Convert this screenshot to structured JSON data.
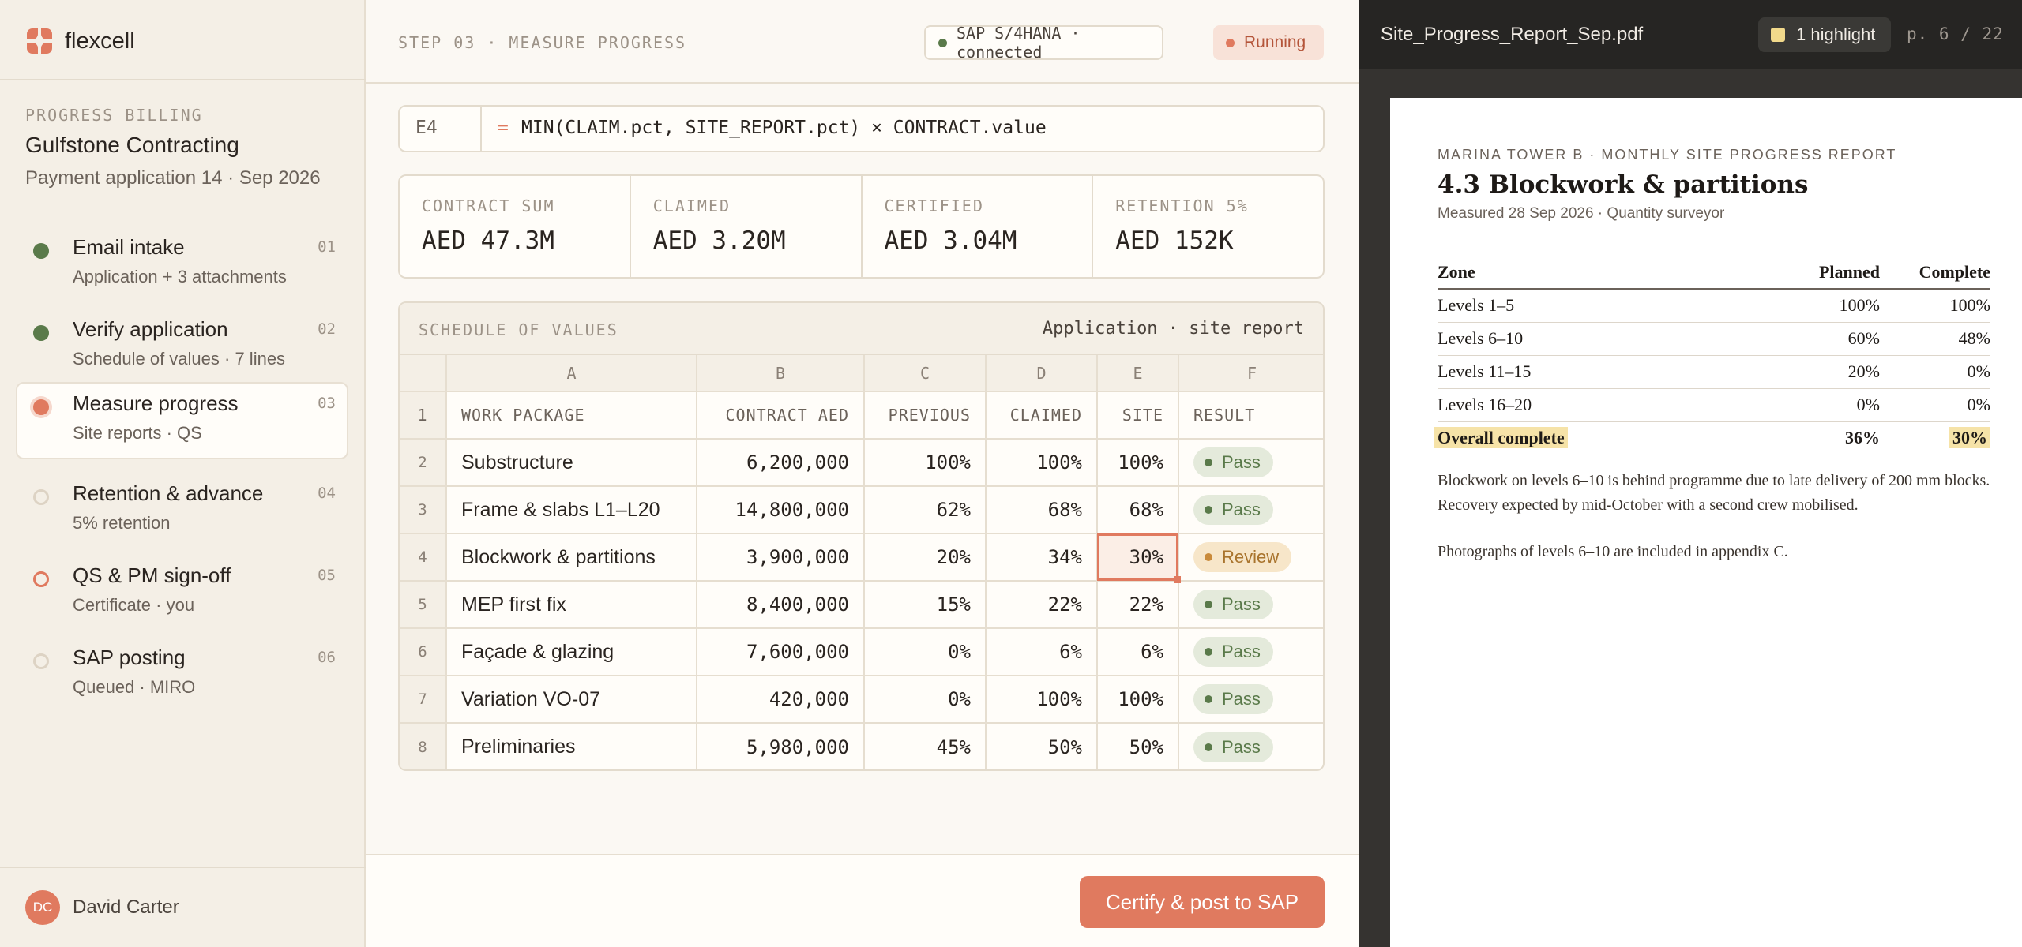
{
  "brand": {
    "name": "flexcell",
    "icon": "flexcell-logo-icon"
  },
  "sidebar": {
    "section_label": "PROGRESS BILLING",
    "client": "Gulfstone Contracting",
    "application": "Payment application 14 · Sep 2026",
    "steps": [
      {
        "title": "Email intake",
        "subtitle": "Application + 3 attachments",
        "num": "01",
        "state": "done"
      },
      {
        "title": "Verify application",
        "subtitle": "Schedule of values · 7 lines",
        "num": "02",
        "state": "done"
      },
      {
        "title": "Measure progress",
        "subtitle": "Site reports · QS",
        "num": "03",
        "state": "active"
      },
      {
        "title": "Retention & advance",
        "subtitle": "5% retention",
        "num": "04",
        "state": "pending"
      },
      {
        "title": "QS & PM sign-off",
        "subtitle": "Certificate · you",
        "num": "05",
        "state": "warn"
      },
      {
        "title": "SAP posting",
        "subtitle": "Queued · MIRO",
        "num": "06",
        "state": "pending"
      }
    ],
    "user": {
      "initials": "DC",
      "name": "David Carter"
    }
  },
  "header": {
    "step_label": "STEP 03 · MEASURE PROGRESS",
    "sap_status": "SAP S/4HANA · connected",
    "run_status": "Running"
  },
  "formula": {
    "cell": "E4",
    "eq": "=",
    "expression": "MIN(CLAIM.pct, SITE_REPORT.pct) × CONTRACT.value"
  },
  "stats": [
    {
      "label": "CONTRACT SUM",
      "value": "AED 47.3M"
    },
    {
      "label": "CLAIMED",
      "value": "AED 3.20M"
    },
    {
      "label": "CERTIFIED",
      "value": "AED 3.04M"
    },
    {
      "label": "RETENTION 5%",
      "value": "AED 152K"
    }
  ],
  "sov": {
    "title": "SCHEDULE OF VALUES",
    "source": "Application · site report",
    "col_letters": [
      "A",
      "B",
      "C",
      "D",
      "E",
      "F"
    ],
    "headers": [
      "WORK PACKAGE",
      "CONTRACT AED",
      "PREVIOUS",
      "CLAIMED",
      "SITE",
      "RESULT"
    ],
    "rows": [
      {
        "n": "2",
        "pkg": "Substructure",
        "contract": "6,200,000",
        "prev": "100%",
        "claimed": "100%",
        "site": "100%",
        "result": "Pass"
      },
      {
        "n": "3",
        "pkg": "Frame & slabs L1–L20",
        "contract": "14,800,000",
        "prev": "62%",
        "claimed": "68%",
        "site": "68%",
        "result": "Pass"
      },
      {
        "n": "4",
        "pkg": "Blockwork & partitions",
        "contract": "3,900,000",
        "prev": "20%",
        "claimed": "34%",
        "site": "30%",
        "result": "Review"
      },
      {
        "n": "5",
        "pkg": "MEP first fix",
        "contract": "8,400,000",
        "prev": "15%",
        "claimed": "22%",
        "site": "22%",
        "result": "Pass"
      },
      {
        "n": "6",
        "pkg": "Façade & glazing",
        "contract": "7,600,000",
        "prev": "0%",
        "claimed": "6%",
        "site": "6%",
        "result": "Pass"
      },
      {
        "n": "7",
        "pkg": "Variation VO-07",
        "contract": "420,000",
        "prev": "0%",
        "claimed": "100%",
        "site": "100%",
        "result": "Pass"
      },
      {
        "n": "8",
        "pkg": "Preliminaries",
        "contract": "5,980,000",
        "prev": "45%",
        "claimed": "50%",
        "site": "50%",
        "result": "Pass"
      }
    ]
  },
  "cta": {
    "label": "Certify & post to SAP"
  },
  "viewer": {
    "filename": "Site_Progress_Report_Sep.pdf",
    "highlights": "1 highlight",
    "page": "p. 6 / 22",
    "doc": {
      "kicker": "MARINA TOWER B · MONTHLY SITE PROGRESS REPORT",
      "title": "4.3 Blockwork & partitions",
      "meta": "Measured 28 Sep 2026 · Quantity surveyor",
      "table_headers": [
        "Zone",
        "Planned",
        "Complete"
      ],
      "table_rows": [
        [
          "Levels 1–5",
          "100%",
          "100%"
        ],
        [
          "Levels 6–10",
          "60%",
          "48%"
        ],
        [
          "Levels 11–15",
          "20%",
          "0%"
        ],
        [
          "Levels 16–20",
          "0%",
          "0%"
        ]
      ],
      "total_row": [
        "Overall complete",
        "36%",
        "30%"
      ],
      "para1": "Blockwork on levels 6–10 is behind programme due to late delivery of 200 mm blocks. Recovery expected by mid-October with a second crew mobilised.",
      "para2": "Photographs of levels 6–10 are included in appendix C."
    }
  },
  "colors": {
    "accent": "#e07a5f",
    "pass": "#5a7a4a",
    "review": "#c98a3a",
    "highlight": "#f6e3a8"
  }
}
